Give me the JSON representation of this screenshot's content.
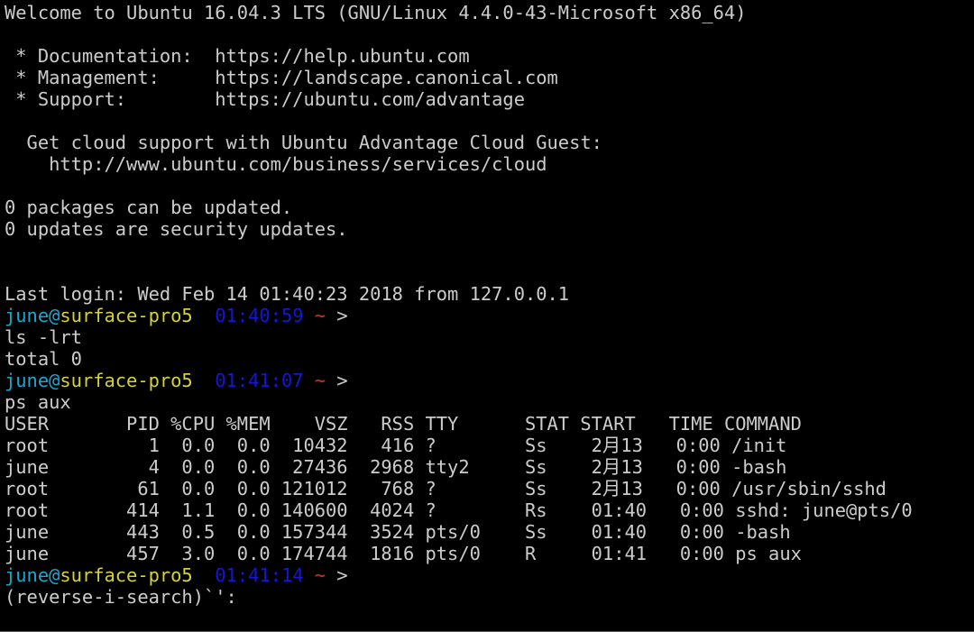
{
  "colors": {
    "background": "#000000",
    "foreground": "#cccccc",
    "prompt_user": "#1aa7cf",
    "prompt_host": "#d6d232",
    "prompt_time": "#1417d6",
    "prompt_tilde": "#d0302a"
  },
  "motd": {
    "welcome": "Welcome to Ubuntu 16.04.3 LTS (GNU/Linux 4.4.0-43-Microsoft x86_64)",
    "documentation": " * Documentation:  https://help.ubuntu.com",
    "management": " * Management:     https://landscape.canonical.com",
    "support": " * Support:        https://ubuntu.com/advantage",
    "cloud_support": "  Get cloud support with Ubuntu Advantage Cloud Guest:",
    "cloud_url": "    http://www.ubuntu.com/business/services/cloud",
    "packages": "0 packages can be updated.",
    "security": "0 updates are security updates.",
    "last_login": "Last login: Wed Feb 14 01:40:23 2018 from 127.0.0.1"
  },
  "session": {
    "prompt_user": "june",
    "prompt_at": "@",
    "prompt_host": "surface-pro5",
    "prompt_tilde": "~",
    "prompt_symbol": ">",
    "prompt_times": [
      "01:40:59",
      "01:41:07",
      "01:41:14"
    ],
    "cmd_ls": "ls -lrt",
    "ls_output": "total 0",
    "cmd_ps": "ps aux",
    "ps_header": "USER       PID %CPU %MEM    VSZ   RSS TTY      STAT START   TIME COMMAND",
    "ps_rows": [
      "root         1  0.0  0.0  10432   416 ?        Ss    2月13   0:00 /init",
      "june         4  0.0  0.0  27436  2968 tty2     Ss    2月13   0:00 -bash",
      "root        61  0.0  0.0 121012   768 ?        Ss    2月13   0:00 /usr/sbin/sshd",
      "root       414  1.1  0.0 140600  4024 ?        Rs    01:40   0:00 sshd: june@pts/0",
      "june       443  0.5  0.0 157344  3524 pts/0    Ss    01:40   0:00 -bash",
      "june       457  3.0  0.0 174744  1816 pts/0    R     01:41   0:00 ps aux"
    ],
    "reverse_search": "(reverse-i-search)`':"
  }
}
